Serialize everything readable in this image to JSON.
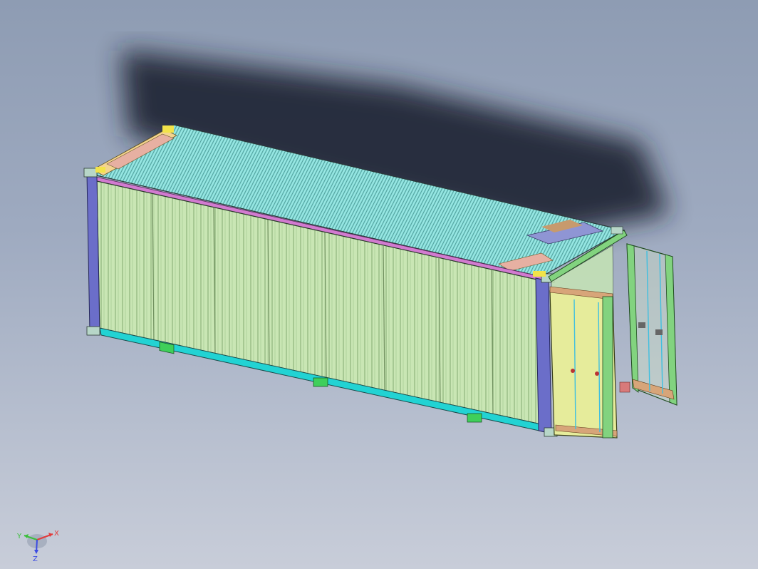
{
  "viewport": {
    "background_top": "#8e9cb3",
    "background_bottom": "#c8cdd9"
  },
  "model": {
    "colors": {
      "side_panel": "#c9e6b4",
      "roof_panel": "#86e0dc",
      "bottom_rail": "#22d3d3",
      "corner_post": "#6b6ec9",
      "top_rail": "#d27bd0",
      "door_panel": "#e6ec9b",
      "door_frame": "#82d37f",
      "door_bars": "#d7a579",
      "forklift_pocket": "#3fcf5a",
      "corner_marker": "#f2e34a"
    },
    "right_door_open": true,
    "left_door_open": true
  },
  "triad": {
    "x_label": "X",
    "y_label": "Y",
    "z_label": "Z",
    "x_color": "#e23b3b",
    "y_color": "#3bbf3b",
    "z_color": "#3b4be2"
  }
}
